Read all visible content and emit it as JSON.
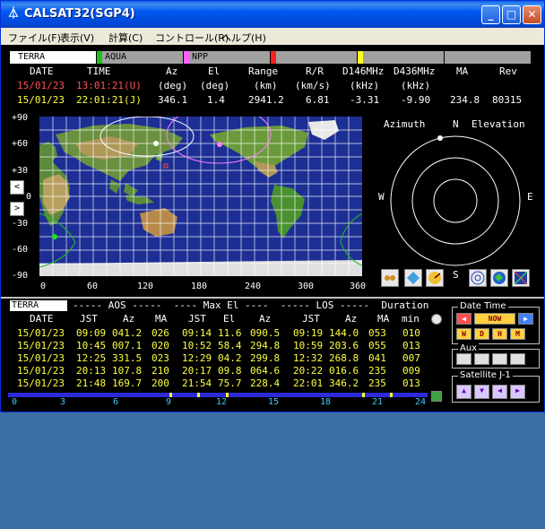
{
  "window": {
    "title": "CALSAT32(SGP4)",
    "minimize": "_",
    "maximize": "□",
    "close": "✕"
  },
  "menu": [
    "ファイル(F)",
    "表示(V)",
    "計算(C)",
    "コントロール(R)",
    "ヘルプ(H)"
  ],
  "satellites": [
    {
      "name": "TERRA",
      "color": "#ffffff",
      "active": true
    },
    {
      "name": "AQUA",
      "color": "#20c020",
      "active": false
    },
    {
      "name": "NPP",
      "color": "#ff60ff",
      "active": false
    },
    {
      "name": "",
      "color": "#ff2020",
      "active": false
    },
    {
      "name": "",
      "color": "#ffff20",
      "active": false
    },
    {
      "name": "",
      "color": "#a0a0a0",
      "active": false
    }
  ],
  "header": {
    "labels": [
      "DATE",
      "TIME",
      "Az",
      "El",
      "Range",
      "R/R",
      "D146MHz",
      "D436MHz",
      "MA",
      "Rev"
    ],
    "units": [
      "(deg)",
      "(deg)",
      "(km)",
      "(km/s)",
      "(kHz)",
      "(kHz)"
    ],
    "utc_date": "15/01/23",
    "utc_time": "13:01:21(U)",
    "jst_date": "15/01/23",
    "jst_time": "22:01:21(J)",
    "az": "346.1",
    "el": "1.4",
    "range": "2941.2",
    "rr": "6.81",
    "d146": "-3.31",
    "d436": "-9.90",
    "ma": "234.8",
    "rev": "80315"
  },
  "map": {
    "lat_labels": [
      "+90",
      "+60",
      "+30",
      "0",
      "-30",
      "-60",
      "-90"
    ],
    "lon_labels": [
      "0",
      "60",
      "120",
      "180",
      "240",
      "300",
      "360"
    ],
    "prev_button": "<",
    "next_button": ">"
  },
  "polar": {
    "azimuth_label": "Azimuth",
    "elevation_label": "Elevation",
    "north": "N",
    "south": "S",
    "east": "E",
    "west": "W"
  },
  "passes": {
    "sat_name": "TERRA",
    "section_header": "----- AOS -----  ---- Max El ----  ----- LOS -----  Duration",
    "col_headers": [
      "DATE",
      "JST",
      "Az",
      "MA",
      "JST",
      "El",
      "Az",
      "JST",
      "Az",
      "MA",
      "min"
    ],
    "rows": [
      [
        "15/01/23",
        "09:09",
        "041.2",
        "026",
        "09:14",
        "11.6",
        "090.5",
        "09:19",
        "144.0",
        "053",
        "010"
      ],
      [
        "15/01/23",
        "10:45",
        "007.1",
        "020",
        "10:52",
        "58.4",
        "294.8",
        "10:59",
        "203.6",
        "055",
        "013"
      ],
      [
        "15/01/23",
        "12:25",
        "331.5",
        "023",
        "12:29",
        "04.2",
        "299.8",
        "12:32",
        "268.8",
        "041",
        "007"
      ],
      [
        "15/01/23",
        "20:13",
        "107.8",
        "210",
        "20:17",
        "09.8",
        "064.6",
        "20:22",
        "016.6",
        "235",
        "009"
      ],
      [
        "15/01/23",
        "21:48",
        "169.7",
        "200",
        "21:54",
        "75.7",
        "228.4",
        "22:01",
        "346.2",
        "235",
        "013"
      ]
    ],
    "timeline_labels": [
      "0",
      "3",
      "6",
      "9",
      "12",
      "15",
      "18",
      "21",
      "24"
    ],
    "timeline_marks": [
      9.25,
      10.8,
      12.45,
      20.25,
      21.85
    ]
  },
  "controls": {
    "datetime_title": "Date Time",
    "now_label": "NOW",
    "w_label": "W",
    "d_label": "D",
    "h_label": "H",
    "m_label": "M",
    "aux_title": "Aux",
    "satellite_title": "Satellite",
    "satellite_group": "J-1"
  }
}
